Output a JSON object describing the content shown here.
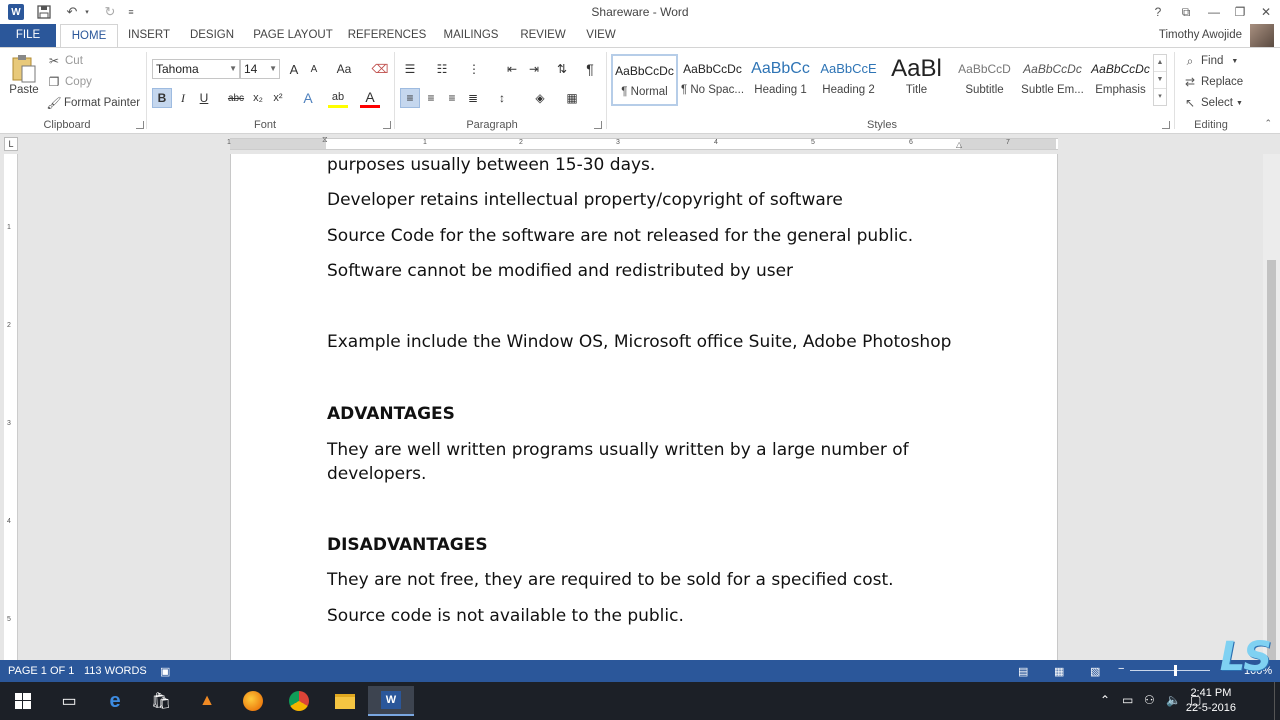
{
  "window": {
    "title": "Shareware - Word",
    "help": "?",
    "restore_ribbon": "⧉",
    "minimize": "—",
    "maximize": "❐",
    "close": "✕"
  },
  "quick_access": {
    "app_icon": "W",
    "save_icon": "save-icon",
    "undo_icon": "undo-icon",
    "redo_icon": "redo-icon",
    "customize_icon": "customize-icon"
  },
  "tabs": [
    "FILE",
    "HOME",
    "INSERT",
    "DESIGN",
    "PAGE LAYOUT",
    "REFERENCES",
    "MAILINGS",
    "REVIEW",
    "VIEW"
  ],
  "user": "Timothy Awojide",
  "clipboard": {
    "paste": "Paste",
    "cut": "Cut",
    "copy": "Copy",
    "format_painter": "Format Painter",
    "label": "Clipboard"
  },
  "font": {
    "name": "Tahoma",
    "size": "14",
    "label": "Font",
    "grow": "A",
    "shrink": "A",
    "case": "Aa",
    "bold": "B",
    "italic": "I",
    "underline": "U",
    "strike": "abc",
    "subscript": "x₂",
    "superscript": "x²",
    "effects": "A",
    "highlight": "ab",
    "color": "A"
  },
  "paragraph": {
    "label": "Paragraph",
    "show_marks": "¶"
  },
  "styles": {
    "label": "Styles",
    "items": [
      {
        "preview": "AaBbCcDc",
        "name": "¶ Normal"
      },
      {
        "preview": "AaBbCcDc",
        "name": "¶ No Spac..."
      },
      {
        "preview": "AaBbCc",
        "name": "Heading 1"
      },
      {
        "preview": "AaBbCcE",
        "name": "Heading 2"
      },
      {
        "preview": "AaBl",
        "name": "Title"
      },
      {
        "preview": "AaBbCcD",
        "name": "Subtitle"
      },
      {
        "preview": "AaBbCcDc",
        "name": "Subtle Em..."
      },
      {
        "preview": "AaBbCcDc",
        "name": "Emphasis"
      }
    ]
  },
  "editing": {
    "find": "Find",
    "replace": "Replace",
    "select": "Select",
    "label": "Editing"
  },
  "ruler": {
    "numbers": [
      "1",
      "1",
      "2",
      "3",
      "4",
      "5",
      "6",
      "7"
    ],
    "vertical": [
      "1",
      "2",
      "3",
      "4",
      "5",
      "6"
    ],
    "tab_selector": "L"
  },
  "document": {
    "paragraphs": [
      "purposes usually between 15-30 days.",
      "Developer retains intellectual property/copyright of software",
      "Source Code for the software are not released for the general public.",
      "Software cannot be modified and redistributed by user",
      "Example include the Window OS, Microsoft office Suite, Adobe Photoshop",
      "ADVANTAGES",
      "They are well written programs usually written by a large number of developers.",
      "DISADVANTAGES",
      "They are not free, they are required to be sold for a specified cost.",
      "Source code is not available to the public."
    ]
  },
  "status": {
    "page": "PAGE 1 OF 1",
    "words": "113 WORDS",
    "zoom": "100%"
  },
  "watermark": "LS",
  "taskbar": {
    "time": "2:41 PM",
    "date": "22-5-2016"
  },
  "colors": {
    "accent": "#2b579a",
    "taskbar": "#1c2027"
  }
}
